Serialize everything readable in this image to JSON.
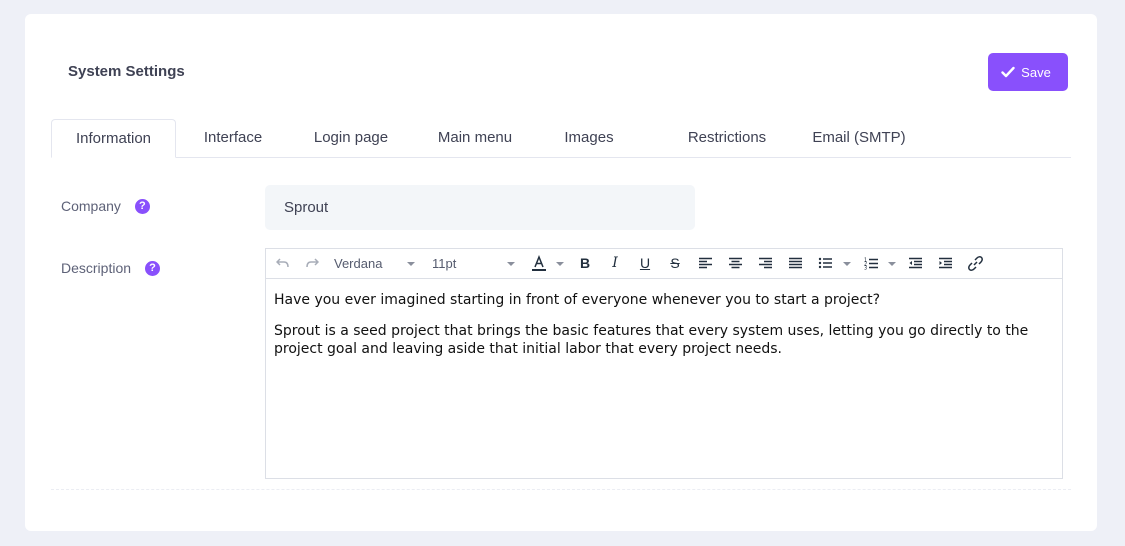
{
  "header": {
    "title": "System Settings",
    "save_label": "Save",
    "accent_color": "#8950fc"
  },
  "tabs": [
    {
      "label": "Information",
      "active": true
    },
    {
      "label": "Interface",
      "active": false
    },
    {
      "label": "Login page",
      "active": false
    },
    {
      "label": "Main menu",
      "active": false
    },
    {
      "label": "Images",
      "active": false
    },
    {
      "label": "Restrictions",
      "active": false
    },
    {
      "label": "Email (SMTP)",
      "active": false
    }
  ],
  "form": {
    "company_label": "Company",
    "company_value": "Sprout",
    "description_label": "Description"
  },
  "editor": {
    "font_family": "Verdana",
    "font_size": "11pt",
    "toolbar_icons": [
      "undo-icon",
      "redo-icon",
      "text-color-icon",
      "bold-icon",
      "italic-icon",
      "underline-icon",
      "strikethrough-icon",
      "align-left-icon",
      "align-center-icon",
      "align-right-icon",
      "align-justify-icon",
      "bullet-list-icon",
      "numbered-list-icon",
      "outdent-icon",
      "indent-icon",
      "link-icon"
    ],
    "paragraphs": [
      "Have you ever imagined starting in front of everyone whenever you to start a project?",
      "Sprout is a seed project that brings the basic features that every system uses, letting you go directly to the project goal and leaving aside that initial labor that every project needs."
    ]
  }
}
